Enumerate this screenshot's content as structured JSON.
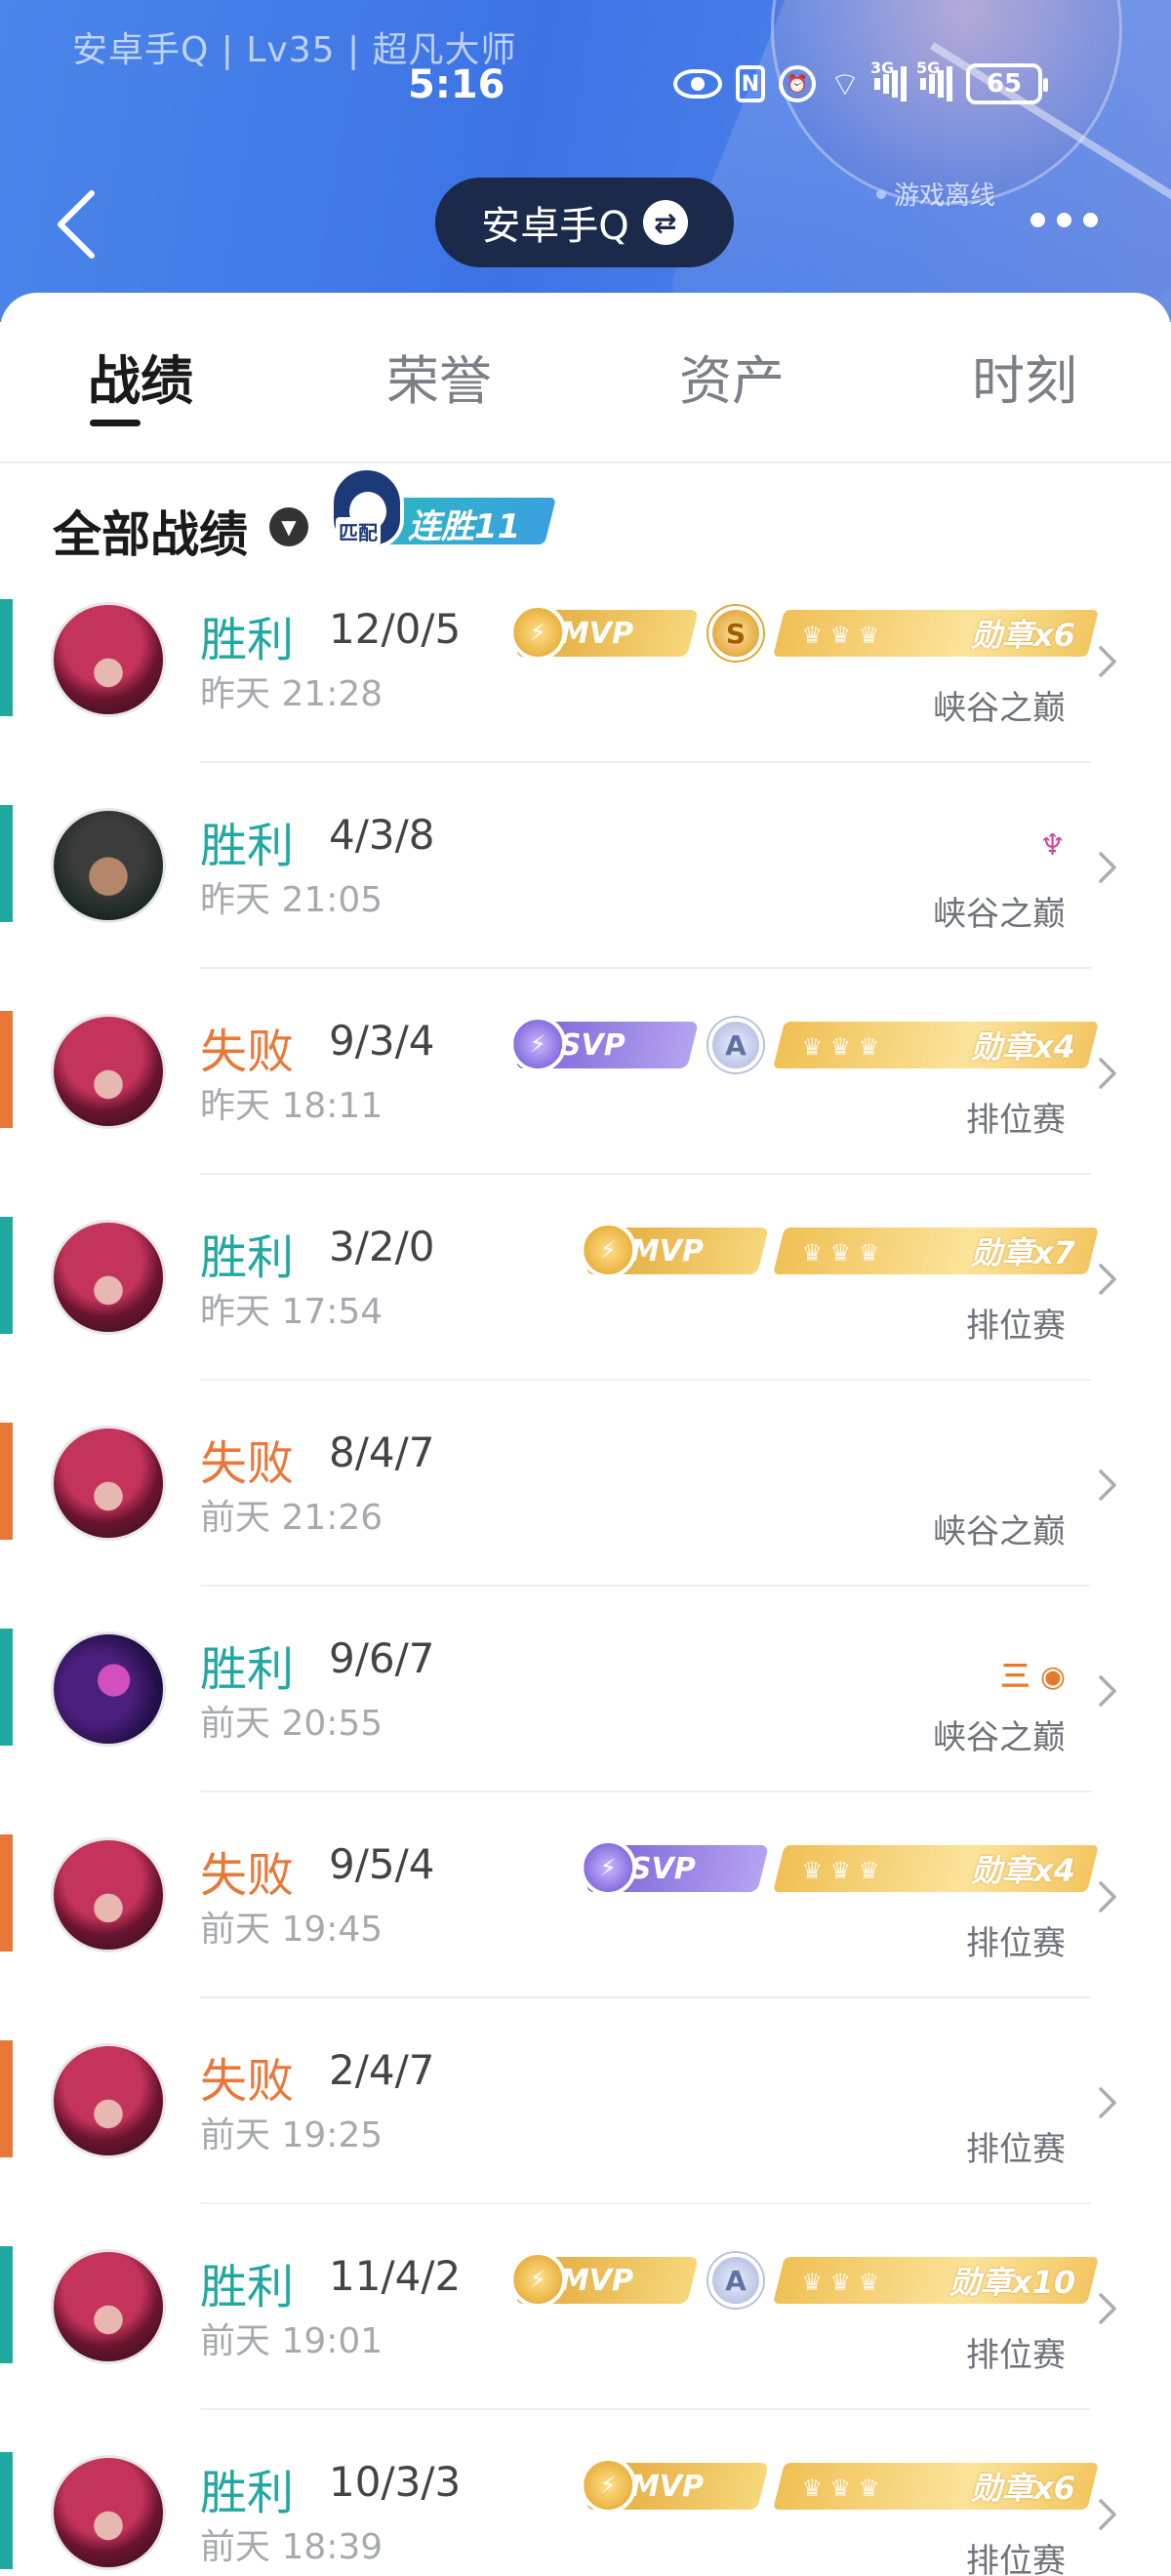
{
  "status_bar": {
    "player_info": "安卓手Q | Lv35 | 超凡大师",
    "time": "5:16",
    "signal_labels": [
      "3G",
      "5G"
    ],
    "battery": "65"
  },
  "header": {
    "account": "安卓手Q",
    "offline_status": "游戏离线"
  },
  "tabs": [
    {
      "label": "战绩",
      "active": true
    },
    {
      "label": "荣誉",
      "active": false
    },
    {
      "label": "资产",
      "active": false
    },
    {
      "label": "时刻",
      "active": false
    }
  ],
  "section": {
    "title": "全部战绩",
    "streak_mode": "匹配",
    "streak_label": "连胜11"
  },
  "colors": {
    "win": "#21a8a0",
    "loss": "#e8783a"
  },
  "matches": [
    {
      "result": "胜利",
      "outcome": "win",
      "kda": "12/0/5",
      "time": "昨天 21:28",
      "mode": "峡谷之巅",
      "hero": "red",
      "perf_badge": "MVP",
      "rank_badge": "S",
      "medal": "勋章x6",
      "icon": null
    },
    {
      "result": "胜利",
      "outcome": "win",
      "kda": "4/3/8",
      "time": "昨天 21:05",
      "mode": "峡谷之巅",
      "hero": "dark",
      "perf_badge": null,
      "rank_badge": null,
      "medal": null,
      "icon": "pink-devil-icon"
    },
    {
      "result": "失败",
      "outcome": "loss",
      "kda": "9/3/4",
      "time": "昨天 18:11",
      "mode": "排位赛",
      "hero": "red",
      "perf_badge": "SVP",
      "rank_badge": "A",
      "medal": "勋章x4",
      "icon": null
    },
    {
      "result": "胜利",
      "outcome": "win",
      "kda": "3/2/0",
      "time": "昨天 17:54",
      "mode": "排位赛",
      "hero": "red",
      "perf_badge": "MVP",
      "rank_badge": null,
      "medal": "勋章x7",
      "icon": null
    },
    {
      "result": "失败",
      "outcome": "loss",
      "kda": "8/4/7",
      "time": "前天 21:26",
      "mode": "峡谷之巅",
      "hero": "red",
      "perf_badge": null,
      "rank_badge": null,
      "medal": null,
      "icon": null
    },
    {
      "result": "胜利",
      "outcome": "win",
      "kda": "9/6/7",
      "time": "前天 20:55",
      "mode": "峡谷之巅",
      "hero": "purple",
      "perf_badge": null,
      "rank_badge": null,
      "medal": null,
      "icon": "triple-kill-coin-icon"
    },
    {
      "result": "失败",
      "outcome": "loss",
      "kda": "9/5/4",
      "time": "前天 19:45",
      "mode": "排位赛",
      "hero": "red",
      "perf_badge": "SVP",
      "rank_badge": null,
      "medal": "勋章x4",
      "icon": null
    },
    {
      "result": "失败",
      "outcome": "loss",
      "kda": "2/4/7",
      "time": "前天 19:25",
      "mode": "排位赛",
      "hero": "red",
      "perf_badge": null,
      "rank_badge": null,
      "medal": null,
      "icon": null
    },
    {
      "result": "胜利",
      "outcome": "win",
      "kda": "11/4/2",
      "time": "前天 19:01",
      "mode": "排位赛",
      "hero": "red",
      "perf_badge": "MVP",
      "rank_badge": "A",
      "medal": "勋章x10",
      "icon": null
    },
    {
      "result": "胜利",
      "outcome": "win",
      "kda": "10/3/3",
      "time": "前天 18:39",
      "mode": "排位赛",
      "hero": "red",
      "perf_badge": "MVP",
      "rank_badge": null,
      "medal": "勋章x6",
      "icon": null
    }
  ]
}
